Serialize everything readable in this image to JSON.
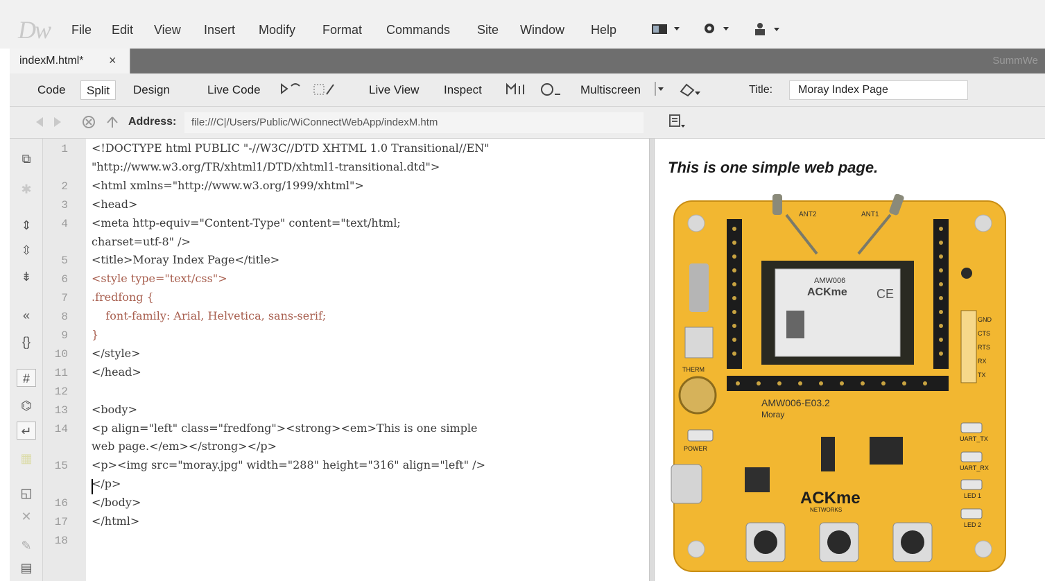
{
  "app": {
    "logo": "Dw"
  },
  "menu": {
    "items": [
      "File",
      "Edit",
      "View",
      "Insert",
      "Modify",
      "Format",
      "Commands",
      "Site",
      "Window",
      "Help"
    ],
    "icons": [
      "layout-icon",
      "gear-icon",
      "user-icon"
    ]
  },
  "tabs": [
    {
      "label": "indexM.html*",
      "close": "×"
    }
  ],
  "tabbar_right": "SummWe",
  "toolbar": {
    "code": "Code",
    "split": "Split",
    "design": "Design",
    "live_code": "Live Code",
    "live_view": "Live View",
    "inspect": "Inspect",
    "multiscreen": "Multiscreen",
    "title_label": "Title:",
    "title_value": "Moray Index Page"
  },
  "address": {
    "label": "Address:",
    "value": "file:///C|/Users/Public/WiConnectWebApp/indexM.htm"
  },
  "editor": {
    "lines": [
      {
        "n": "1",
        "text": "<!DOCTYPE html PUBLIC \"-//W3C//DTD XHTML 1.0 Transitional//EN\""
      },
      {
        "n": "",
        "text": "\"http://www.w3.org/TR/xhtml1/DTD/xhtml1-transitional.dtd\">"
      },
      {
        "n": "2",
        "text": "<html xmlns=\"http://www.w3.org/1999/xhtml\">"
      },
      {
        "n": "3",
        "text": "<head>"
      },
      {
        "n": "4",
        "text": "<meta http-equiv=\"Content-Type\" content=\"text/html;"
      },
      {
        "n": "",
        "text": "charset=utf-8\" />"
      },
      {
        "n": "5",
        "text": "<title>Moray Index Page</title>"
      },
      {
        "n": "6",
        "text": "<style type=\"text/css\">"
      },
      {
        "n": "7",
        "text": ".fredfong {"
      },
      {
        "n": "8",
        "text": "    font-family: Arial, Helvetica, sans-serif;"
      },
      {
        "n": "9",
        "text": "}"
      },
      {
        "n": "10",
        "text": "</style>"
      },
      {
        "n": "11",
        "text": "</head>"
      },
      {
        "n": "12",
        "text": ""
      },
      {
        "n": "13",
        "text": "<body>"
      },
      {
        "n": "14",
        "text": "<p align=\"left\" class=\"fredfong\"><strong><em>This is one simple"
      },
      {
        "n": "",
        "text": "web page.</em></strong></p>"
      },
      {
        "n": "15",
        "text": "<p><img src=\"moray.jpg\" width=\"288\" height=\"316\" align=\"left\" />"
      },
      {
        "n": "",
        "text": "</p>"
      },
      {
        "n": "16",
        "text": "</body>"
      },
      {
        "n": "17",
        "text": "</html>"
      },
      {
        "n": "18",
        "text": ""
      }
    ]
  },
  "design_view": {
    "heading": "This is one simple web page.",
    "board": {
      "module_brand": "ACKme",
      "module_model": "AMW006",
      "board_name": "AMW006-E03.2",
      "board_sub": "Moray",
      "logo": "ACKme",
      "logo_sub": "NETWORKS",
      "labels": [
        "ANT2",
        "ANT1",
        "POWER",
        "UART_TX",
        "UART_RX",
        "LED 1",
        "LED 2",
        "THERM",
        "GND",
        "CTS",
        "RTS",
        "RX",
        "TX"
      ]
    }
  }
}
